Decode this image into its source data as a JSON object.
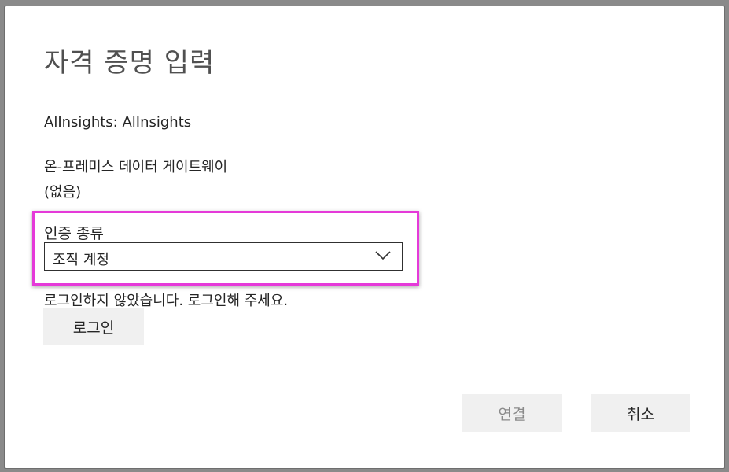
{
  "dialog": {
    "title": "자격 증명 입력",
    "datasource": "AlInsights: AlInsights",
    "gateway_label": "온-프레미스 데이터 게이트웨이",
    "gateway_value": "(없음)",
    "auth_type_label": "인증 종류",
    "auth_type_selected": "조직 계정",
    "signin_message": "로그인하지 않았습니다. 로그인해 주세요.",
    "signin_button": "로그인",
    "connect_button": "연결",
    "cancel_button": "취소"
  },
  "colors": {
    "highlight": "#e53ad9",
    "button_bg": "#f0f0f0",
    "disabled_text": "#8a8a8a"
  },
  "icons": {
    "dropdown": "chevron-down-icon"
  }
}
